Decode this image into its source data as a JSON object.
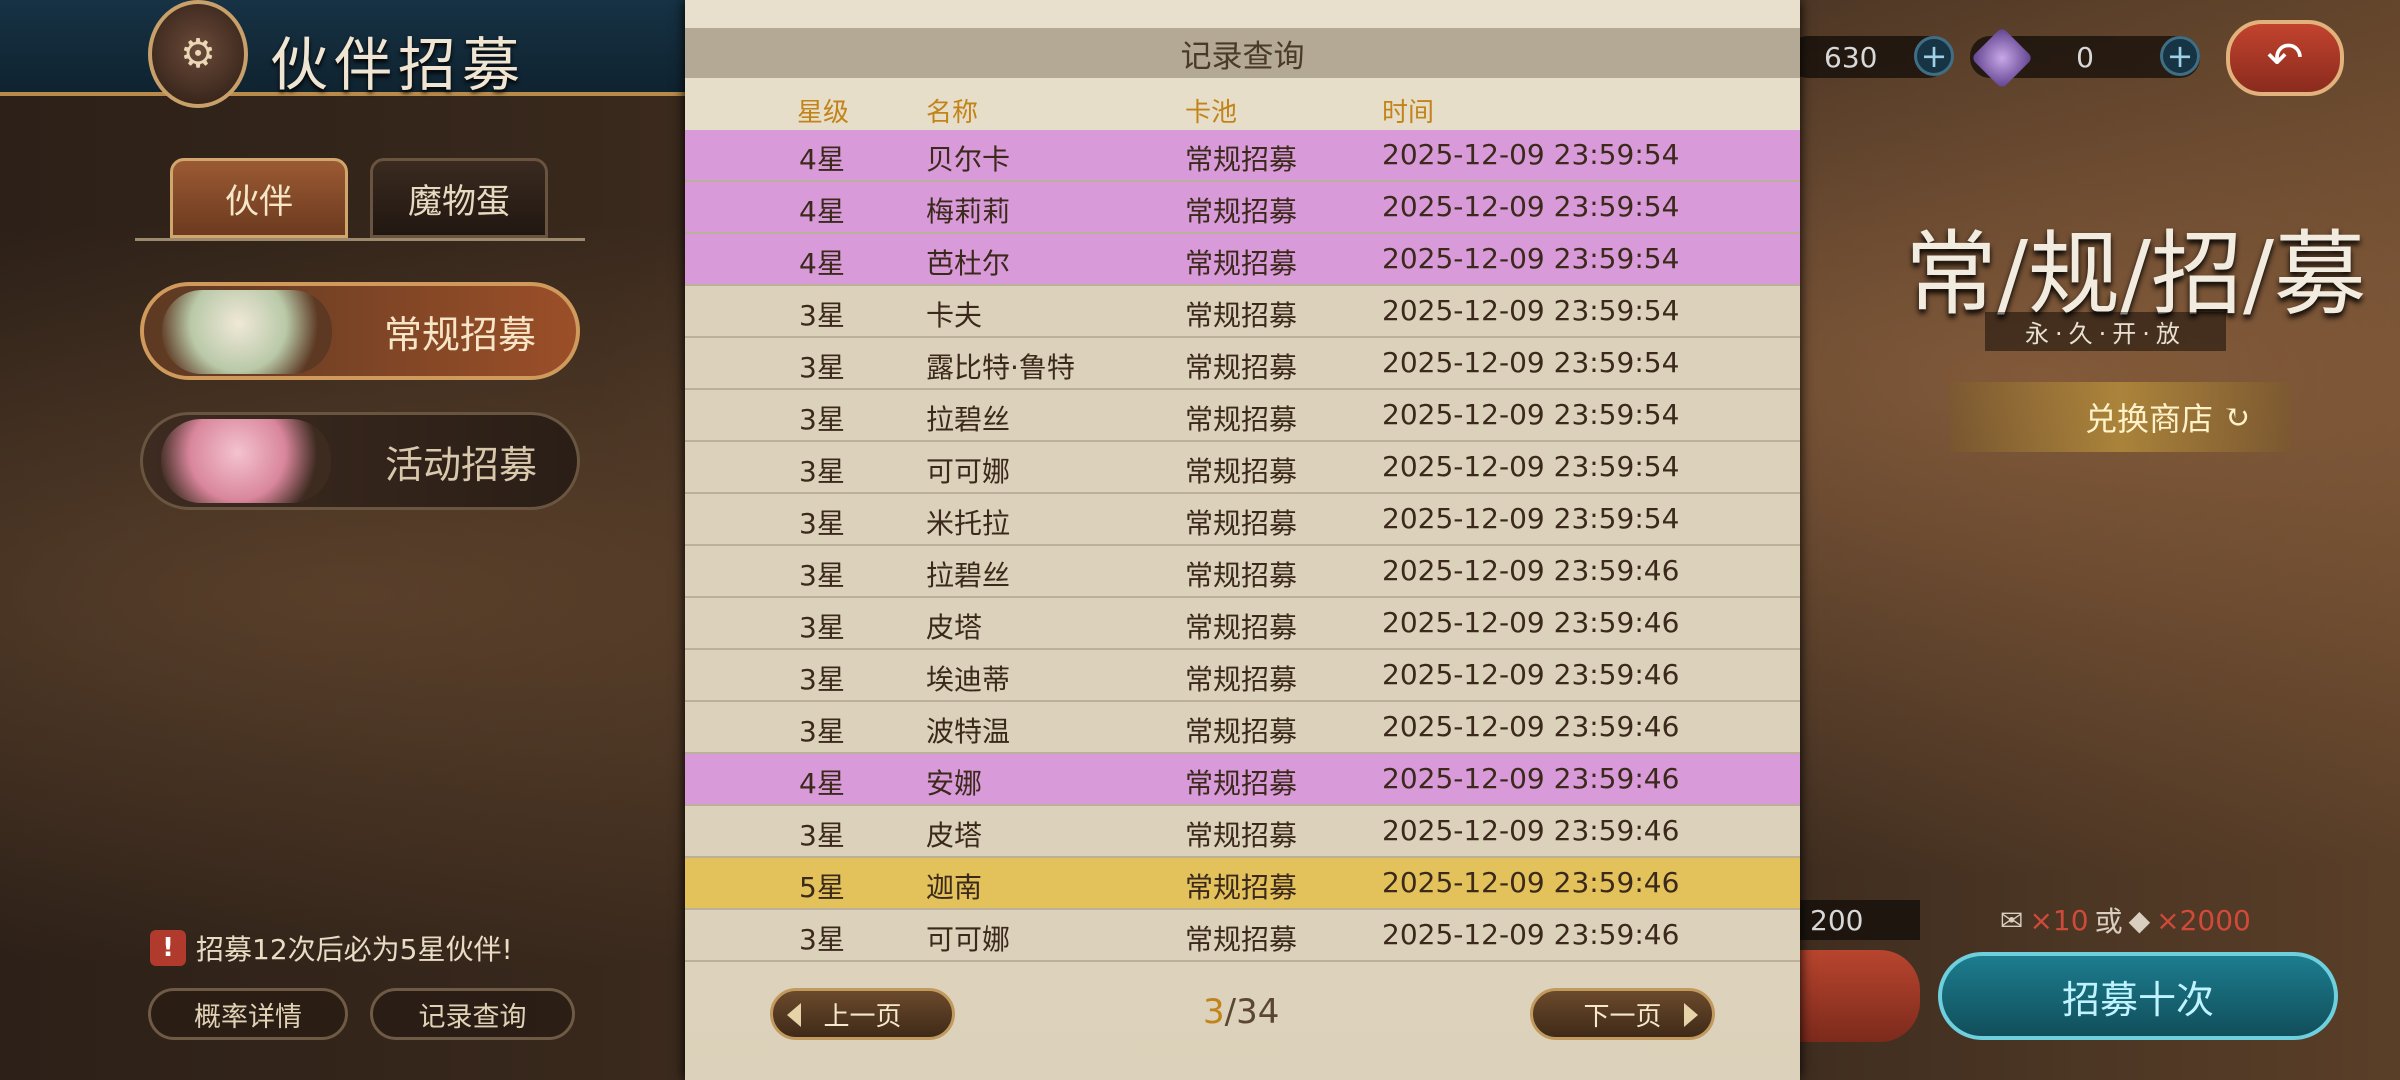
{
  "header": {
    "title": "伙伴招募"
  },
  "tabs": [
    {
      "label": "伙伴"
    },
    {
      "label": "魔物蛋"
    }
  ],
  "recruit_buttons": [
    {
      "label": "常规招募"
    },
    {
      "label": "活动招募"
    }
  ],
  "guarantee_text": "招募12次后必为5星伙伴!",
  "bottom_buttons": {
    "rates": "概率详情",
    "records": "记录查询"
  },
  "resources": {
    "currency1": "630",
    "currency2": "0",
    "currency3": "200"
  },
  "pool": {
    "title": "常/规/招/募",
    "subtitle": "永·久·开·放",
    "shop": "兑换商店"
  },
  "cost": {
    "ticket_count": "×10",
    "or": "或",
    "gem_count": "×2000"
  },
  "ten_pull": "招募十次",
  "modal": {
    "title": "记录查询",
    "columns": {
      "star": "星级",
      "name": "名称",
      "pool": "卡池",
      "time": "时间"
    },
    "rows": [
      {
        "star": "4星",
        "name": "贝尔卡",
        "pool": "常规招募",
        "time": "2025-12-09 23:59:54",
        "rarity": 4
      },
      {
        "star": "4星",
        "name": "梅莉莉",
        "pool": "常规招募",
        "time": "2025-12-09 23:59:54",
        "rarity": 4
      },
      {
        "star": "4星",
        "name": "芭杜尔",
        "pool": "常规招募",
        "time": "2025-12-09 23:59:54",
        "rarity": 4
      },
      {
        "star": "3星",
        "name": "卡夫",
        "pool": "常规招募",
        "time": "2025-12-09 23:59:54",
        "rarity": 3
      },
      {
        "star": "3星",
        "name": "露比特·鲁特",
        "pool": "常规招募",
        "time": "2025-12-09 23:59:54",
        "rarity": 3
      },
      {
        "star": "3星",
        "name": "拉碧丝",
        "pool": "常规招募",
        "time": "2025-12-09 23:59:54",
        "rarity": 3
      },
      {
        "star": "3星",
        "name": "可可娜",
        "pool": "常规招募",
        "time": "2025-12-09 23:59:54",
        "rarity": 3
      },
      {
        "star": "3星",
        "name": "米托拉",
        "pool": "常规招募",
        "time": "2025-12-09 23:59:54",
        "rarity": 3
      },
      {
        "star": "3星",
        "name": "拉碧丝",
        "pool": "常规招募",
        "time": "2025-12-09 23:59:46",
        "rarity": 3
      },
      {
        "star": "3星",
        "name": "皮塔",
        "pool": "常规招募",
        "time": "2025-12-09 23:59:46",
        "rarity": 3
      },
      {
        "star": "3星",
        "name": "埃迪蒂",
        "pool": "常规招募",
        "time": "2025-12-09 23:59:46",
        "rarity": 3
      },
      {
        "star": "3星",
        "name": "波特温",
        "pool": "常规招募",
        "time": "2025-12-09 23:59:46",
        "rarity": 3
      },
      {
        "star": "4星",
        "name": "安娜",
        "pool": "常规招募",
        "time": "2025-12-09 23:59:46",
        "rarity": 4
      },
      {
        "star": "3星",
        "name": "皮塔",
        "pool": "常规招募",
        "time": "2025-12-09 23:59:46",
        "rarity": 3
      },
      {
        "star": "5星",
        "name": "迦南",
        "pool": "常规招募",
        "time": "2025-12-09 23:59:46",
        "rarity": 5
      },
      {
        "star": "3星",
        "name": "可可娜",
        "pool": "常规招募",
        "time": "2025-12-09 23:59:46",
        "rarity": 3
      }
    ],
    "rarity_colors": {
      "3": "#dcd1ba",
      "4": "#d89ad8",
      "5": "#e3c25c"
    },
    "pager": {
      "prev": "上一页",
      "next": "下一页",
      "current": "3",
      "total": "/34"
    }
  }
}
